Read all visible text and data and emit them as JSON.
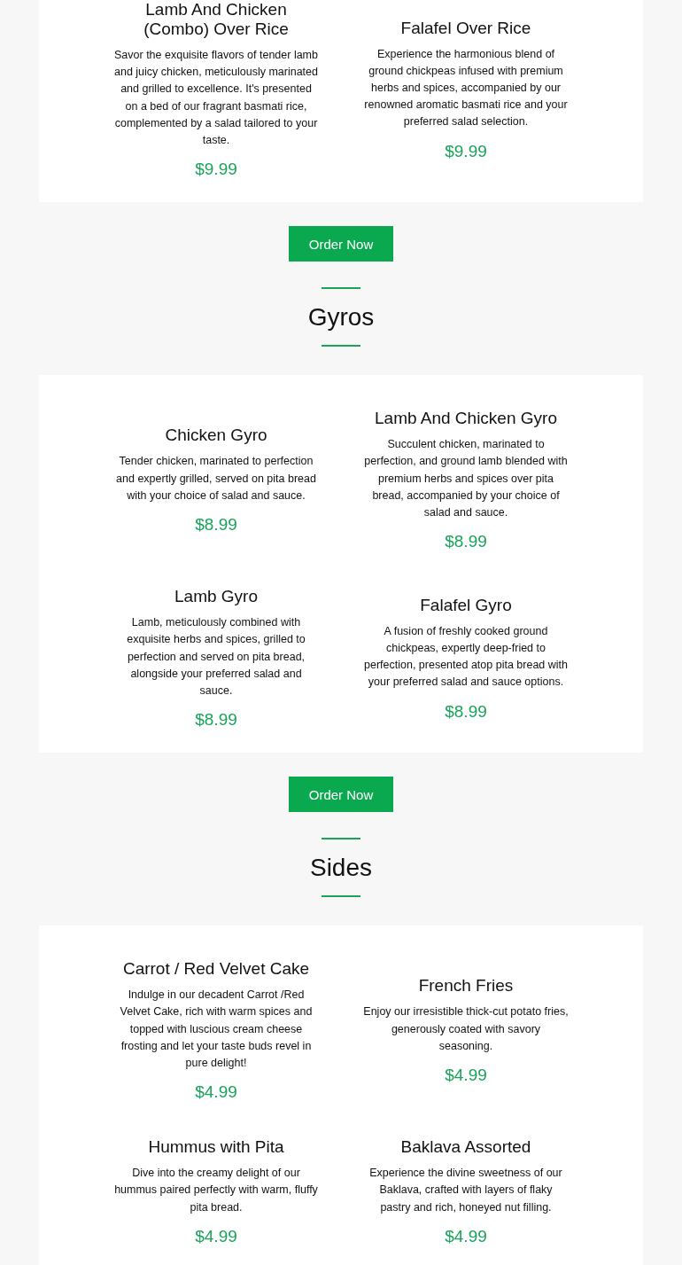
{
  "sections": [
    {
      "items": [
        {
          "name": "Lamb And Chicken (Combo) Over Rice",
          "description": "Savor the exquisite flavors of tender lamb and juicy chicken, meticulously marinated and grilled to excellence. It's presented on a bed of our fragrant basmati rice, complemented by a salad tailored to your taste.",
          "price": "$9.99"
        },
        {
          "name": "Falafel Over Rice",
          "description": "Experience the harmonious blend of ground chickpeas infused with premium herbs and spices, accompanied by our renowned aromatic basmati rice and your preferred salad selection.",
          "price": "$9.99"
        }
      ],
      "button": "Order Now"
    },
    {
      "heading": "Gyros",
      "items": [
        {
          "name": "Chicken Gyro",
          "description": "Tender chicken, marinated to perfection and expertly grilled, served on pita bread with your choice of salad and sauce.",
          "price": "$8.99"
        },
        {
          "name": "Lamb And Chicken Gyro",
          "description": "Succulent chicken, marinated to perfection, and ground lamb blended with premium herbs and spices over pita bread, accompanied by your choice of salad and sauce.",
          "price": "$8.99"
        },
        {
          "name": "Lamb Gyro",
          "description": "Lamb, meticulously combined with exquisite herbs and spices, grilled to perfection and served on pita bread, alongside your preferred salad and sauce.",
          "price": "$8.99"
        },
        {
          "name": "Falafel Gyro",
          "description": "A fusion of freshly cooked ground chickpeas, expertly deep-fried to perfection, presented atop pita bread with your preferred salad and sauce options.",
          "price": "$8.99"
        }
      ],
      "button": "Order Now"
    },
    {
      "heading": "Sides",
      "items": [
        {
          "name": "Carrot / Red Velvet Cake",
          "description": "Indulge in our decadent Carrot /Red Velvet Cake, rich with warm spices and topped with luscious cream cheese frosting and let your taste buds revel in pure delight!",
          "price": "$4.99"
        },
        {
          "name": "French Fries",
          "description": "Enjoy our irresistible thick-cut potato fries, generously coated with savory seasoning.",
          "price": "$4.99"
        },
        {
          "name": "Hummus with Pita",
          "description": "Dive into the creamy delight of our hummus paired perfectly with warm, fluffy pita bread.",
          "price": "$4.99"
        },
        {
          "name": "Baklava Assorted",
          "description": "Experience the divine sweetness of our Baklava, crafted with layers of flaky pastry and rich, honeyed nut filling.",
          "price": "$4.99"
        }
      ]
    }
  ]
}
